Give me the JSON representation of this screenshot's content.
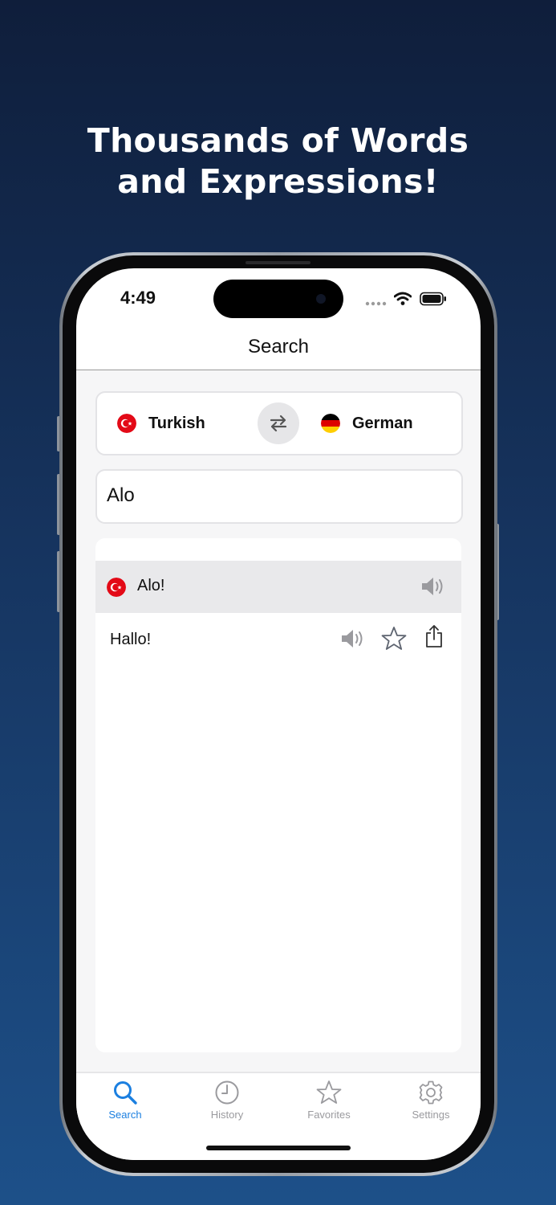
{
  "headline": {
    "line1": "Thousands of Words",
    "line2": "and Expressions!"
  },
  "status_bar": {
    "time": "4:49",
    "icons": [
      "signal-dots-icon",
      "wifi-icon",
      "battery-icon"
    ]
  },
  "nav": {
    "title": "Search"
  },
  "languages": {
    "source": {
      "label": "Turkish",
      "flag": "turkey-flag-icon"
    },
    "target": {
      "label": "German",
      "flag": "germany-flag-icon"
    },
    "swap_icon": "swap-arrows-icon"
  },
  "search": {
    "value": "Alo",
    "placeholder": ""
  },
  "results": {
    "source_phrase": "Alo!",
    "translation": "Hallo!",
    "actions": [
      "speaker-icon",
      "star-icon",
      "share-icon"
    ]
  },
  "tabs": [
    {
      "label": "Search",
      "icon": "magnifier-icon",
      "active": true
    },
    {
      "label": "History",
      "icon": "clock-icon",
      "active": false
    },
    {
      "label": "Favorites",
      "icon": "star-icon",
      "active": false
    },
    {
      "label": "Settings",
      "icon": "gear-icon",
      "active": false
    }
  ],
  "colors": {
    "background_top": "#0f1e3b",
    "background_bottom": "#1d5089",
    "accent": "#1b7fe0",
    "inactive": "#9a9a9e",
    "highlight_row": "#e9e9eb"
  }
}
